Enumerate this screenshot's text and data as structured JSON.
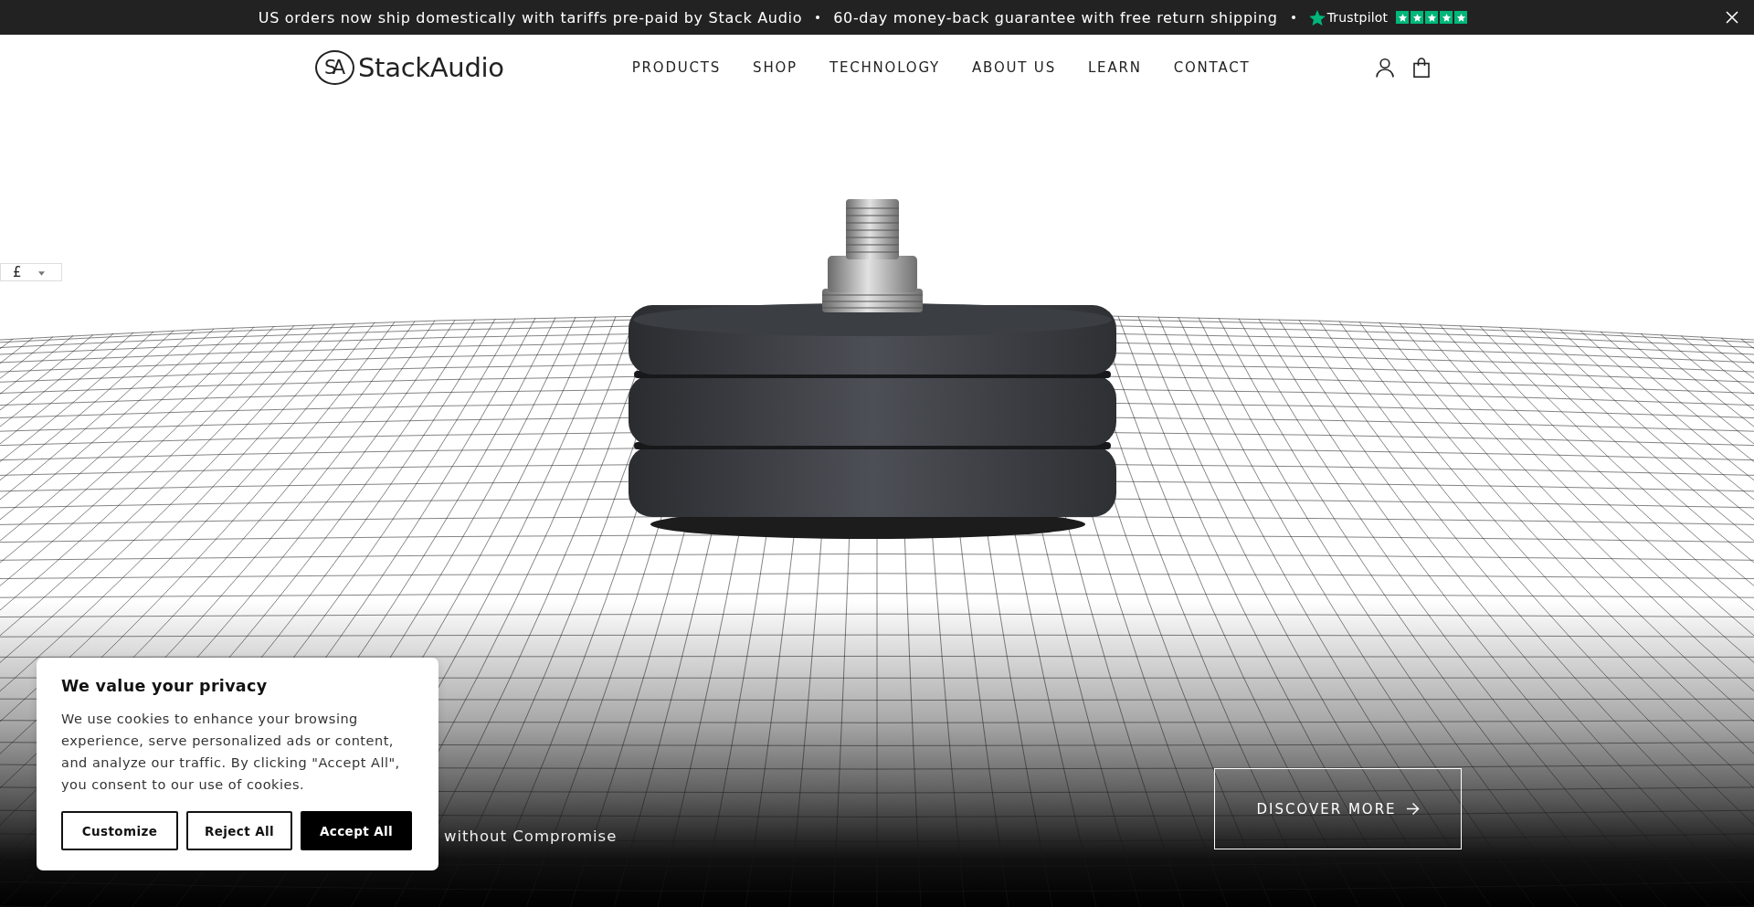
{
  "announcement_bar": {
    "messages": [
      "US orders now ship domestically with tariffs pre-paid by Stack Audio",
      "60-day money-back guarantee with free return shipping"
    ],
    "trustpilot": {
      "label": "Trustpilot",
      "stars": 5
    }
  },
  "header": {
    "logo": {
      "mark": "SA",
      "name": "StackAudio"
    },
    "nav": [
      "PRODUCTS",
      "SHOP",
      "TECHNOLOGY",
      "ABOUT US",
      "LEARN",
      "CONTACT"
    ]
  },
  "currency_selector": {
    "value": "£"
  },
  "hero": {
    "tagline": "without Compromise",
    "button": "DISCOVER MORE"
  },
  "cookie_banner": {
    "title": "We value your privacy",
    "body": "We use cookies to enhance your browsing experience, serve personalized ads or content, and analyze our traffic. By clicking \"Accept All\", you consent to our use of cookies.",
    "buttons": [
      {
        "label": "Customize",
        "kind": "outline"
      },
      {
        "label": "Reject All",
        "kind": "outline"
      },
      {
        "label": "Accept All",
        "kind": "filled"
      }
    ]
  }
}
